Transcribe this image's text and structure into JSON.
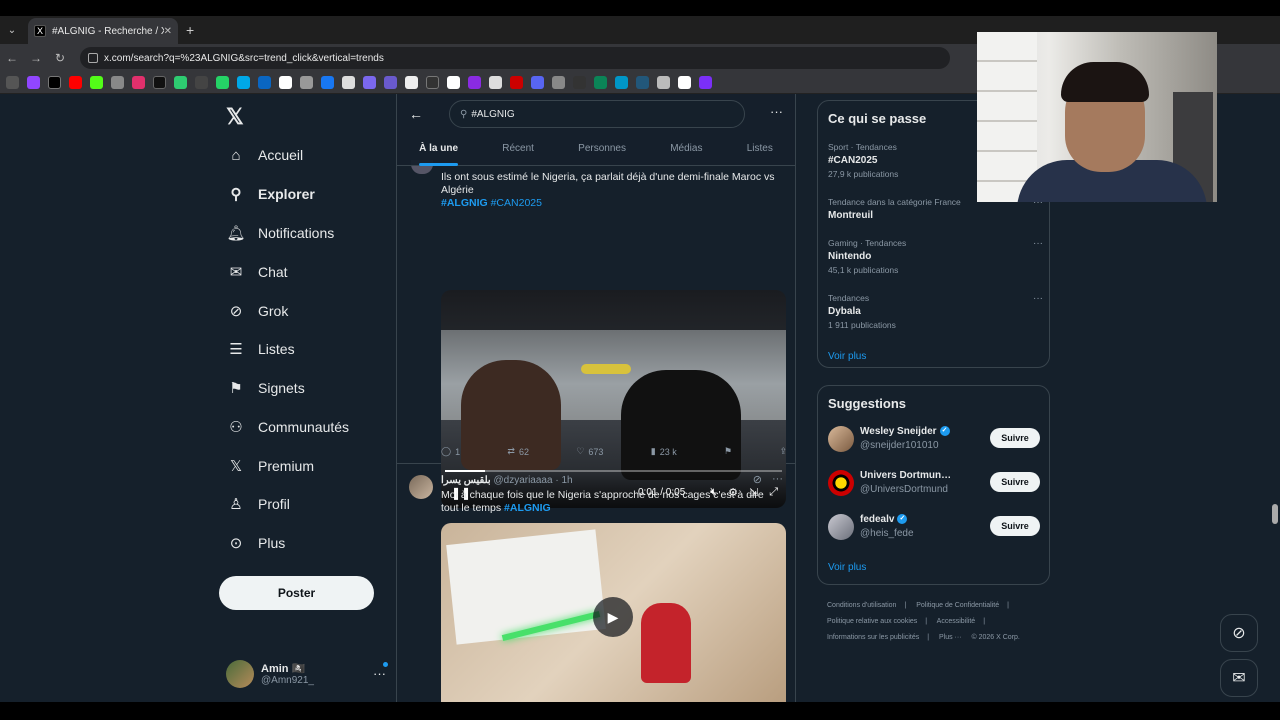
{
  "browser": {
    "tab_title": "#ALGNIG - Recherche / X",
    "tab_close": "✕",
    "new_tab": "+",
    "url": "x.com/search?q=%23ALGNIG&src=trend_click&vertical=trends"
  },
  "nav": {
    "items": [
      {
        "label": "Accueil",
        "icon": "home-icon"
      },
      {
        "label": "Explorer",
        "icon": "search-icon"
      },
      {
        "label": "Notifications",
        "icon": "bell-icon"
      },
      {
        "label": "Chat",
        "icon": "mail-icon"
      },
      {
        "label": "Grok",
        "icon": "grok-icon"
      },
      {
        "label": "Listes",
        "icon": "list-icon"
      },
      {
        "label": "Signets",
        "icon": "bookmark-icon"
      },
      {
        "label": "Communautés",
        "icon": "communities-icon"
      },
      {
        "label": "Premium",
        "icon": "x-icon"
      },
      {
        "label": "Profil",
        "icon": "profile-icon"
      },
      {
        "label": "Plus",
        "icon": "more-circle-icon"
      }
    ],
    "post_button": "Poster",
    "account": {
      "name": "Amin 🏴‍☠️",
      "handle": "@Amn921_"
    }
  },
  "search": {
    "query": "#ALGNIG",
    "tabs": [
      "À la une",
      "Récent",
      "Personnes",
      "Médias",
      "Listes"
    ]
  },
  "tweet1": {
    "text": "Ils ont sous estimé le Nigeria, ça parlait déjà d'une demi-finale Maroc vs Algérie",
    "hashtag1": "#ALGNIG",
    "hashtag2": "#CAN2025",
    "video_time": "0:01 / 0:05",
    "replies": "1",
    "retweets": "62",
    "likes": "673",
    "views": "23 k"
  },
  "tweet2": {
    "author": "بلقيس يسرا",
    "handle": "@dzyariaaaa · 1h",
    "text": "Moi à chaque fois que le Nigeria s'approche de nos cages c'est à dire tout le temps",
    "hashtag": "#ALGNIG"
  },
  "trends": {
    "title": "Ce qui se passe",
    "items": [
      {
        "context": "Sport · Tendances",
        "name": "#CAN2025",
        "count": "27,9 k publications"
      },
      {
        "context": "Tendance dans la catégorie France",
        "name": "Montreuil",
        "count": ""
      },
      {
        "context": "Gaming · Tendances",
        "name": "Nintendo",
        "count": "45,1 k publications"
      },
      {
        "context": "Tendances",
        "name": "Dybala",
        "count": "1 911 publications"
      }
    ],
    "see_more": "Voir plus"
  },
  "suggestions": {
    "title": "Suggestions",
    "items": [
      {
        "name": "Wesley Sneijder",
        "handle": "@sneijder101010",
        "verified": true
      },
      {
        "name": "Univers Dortmund (CA...",
        "handle": "@UniversDortmund",
        "verified": false
      },
      {
        "name": "fedealv",
        "handle": "@heis_fede",
        "verified": true
      }
    ],
    "follow_label": "Suivre",
    "see_more": "Voir plus"
  },
  "footer": {
    "links": [
      "Conditions d'utilisation",
      "Politique de Confidentialité",
      "Politique relative aux cookies",
      "Accessibilité",
      "Informations sur les publicités",
      "Plus ···",
      "© 2026 X Corp."
    ]
  },
  "colors": {
    "accent": "#1d9bf0",
    "background": "#15202b",
    "border": "#38444d"
  }
}
